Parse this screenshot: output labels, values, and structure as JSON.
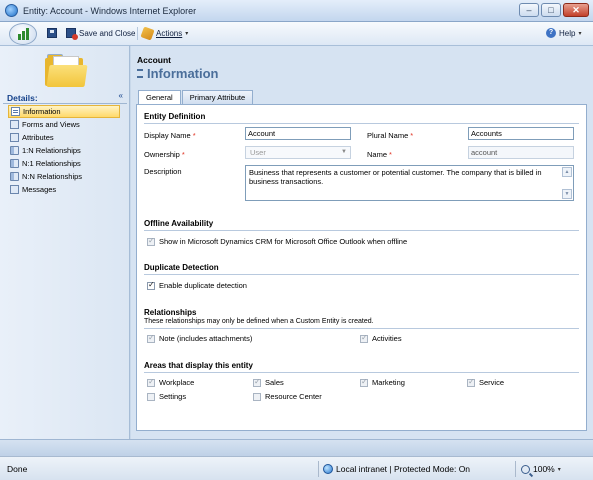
{
  "window": {
    "title": "Entity: Account - Windows Internet Explorer",
    "minimize": "–",
    "maximize": "□",
    "close": "✕"
  },
  "toolbar": {
    "save_close_label": "Save and Close",
    "actions_label": "Actions",
    "actions_arrow": "▾",
    "help_label": "Help",
    "help_arrow": "▾",
    "help_glyph": "?"
  },
  "sidebar": {
    "details_label": "Details:",
    "collapse_glyph": "«",
    "items": [
      {
        "label": "Information",
        "active": true
      },
      {
        "label": "Forms and Views"
      },
      {
        "label": "Attributes"
      },
      {
        "label": "1:N Relationships"
      },
      {
        "label": "N:1 Relationships"
      },
      {
        "label": "N:N Relationships"
      },
      {
        "label": "Messages"
      }
    ]
  },
  "header": {
    "entity": "Account",
    "title": "Information"
  },
  "tabs": [
    {
      "label": "General",
      "active": true
    },
    {
      "label": "Primary Attribute"
    }
  ],
  "form": {
    "entity_definition": {
      "title": "Entity Definition",
      "display_name_label": "Display Name",
      "display_name_value": "Account",
      "plural_name_label": "Plural Name",
      "plural_name_value": "Accounts",
      "ownership_label": "Ownership",
      "ownership_value": "User",
      "name_label": "Name",
      "name_value": "account",
      "description_label": "Description",
      "description_value": "Business that represents a customer or potential customer. The company that is billed in business transactions.",
      "required_mark": "*"
    },
    "offline": {
      "title": "Offline Availability",
      "checkbox_label": "Show in Microsoft Dynamics CRM for Microsoft Office Outlook when offline"
    },
    "duplicate": {
      "title": "Duplicate Detection",
      "checkbox_label": "Enable duplicate detection"
    },
    "relationships": {
      "title": "Relationships",
      "note": "These relationships may only be defined when a Custom Entity is created.",
      "note_label": "Note (includes attachments)",
      "activities_label": "Activities"
    },
    "areas": {
      "title": "Areas that display this entity",
      "workplace": "Workplace",
      "sales": "Sales",
      "marketing": "Marketing",
      "service": "Service",
      "settings": "Settings",
      "resource_center": "Resource Center"
    }
  },
  "status": {
    "done": "Done",
    "zone": "Local intranet | Protected Mode: On",
    "zoom": "100%",
    "zoom_arrow": "▾"
  }
}
